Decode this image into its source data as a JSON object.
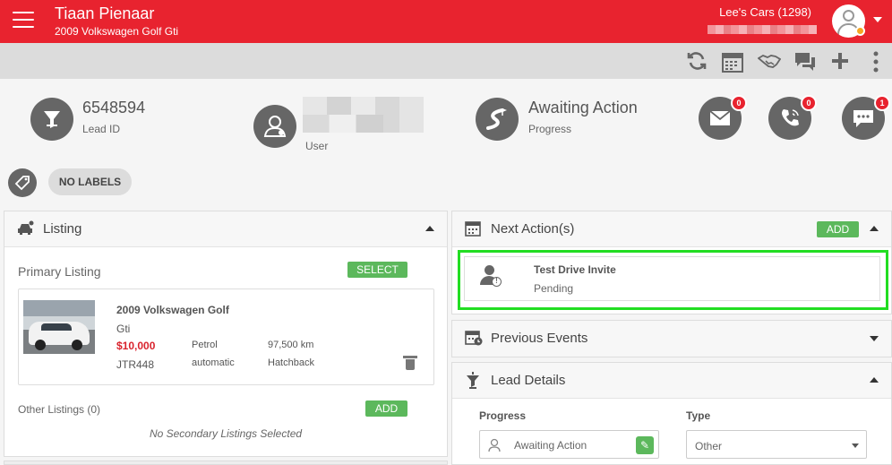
{
  "header": {
    "name": "Tiaan Pienaar",
    "vehicle": "2009 Volkswagen Golf Gti",
    "dealer": "Lee's Cars (1298)",
    "brand_color": "#e8232f"
  },
  "toolbar": {
    "icons": [
      "refresh-icon",
      "calendar-icon",
      "handshake-icon",
      "chat-icon",
      "plus-icon",
      "more-vertical-icon"
    ]
  },
  "summary": {
    "lead_id": "6548594",
    "lead_id_label": "Lead ID",
    "user_label": "User",
    "progress_value": "Awaiting Action",
    "progress_label": "Progress"
  },
  "comms": {
    "email_count": "0",
    "phone_count": "0",
    "message_count": "1"
  },
  "labels": {
    "no_labels": "NO LABELS"
  },
  "listing": {
    "title": "Listing",
    "primary_title": "Primary Listing",
    "select_label": "SELECT",
    "car_title": "2009 Volkswagen Golf",
    "car_variant": "Gti",
    "price": "$10,000",
    "fuel": "Petrol",
    "mileage": "97,500 km",
    "reg": "JTR448",
    "transmission": "automatic",
    "body": "Hatchback",
    "other_title": "Other Listings (0)",
    "add_label": "ADD",
    "empty_text": "No Secondary Listings Selected",
    "price_color": "#d9232d"
  },
  "next_actions": {
    "title": "Next Action(s)",
    "add_label": "ADD",
    "action_title": "Test Drive Invite",
    "action_status": "Pending"
  },
  "previous_events": {
    "title": "Previous Events"
  },
  "lead_details": {
    "title": "Lead Details",
    "progress_label": "Progress",
    "progress_value": "Awaiting Action",
    "type_label": "Type",
    "type_value": "Other"
  }
}
